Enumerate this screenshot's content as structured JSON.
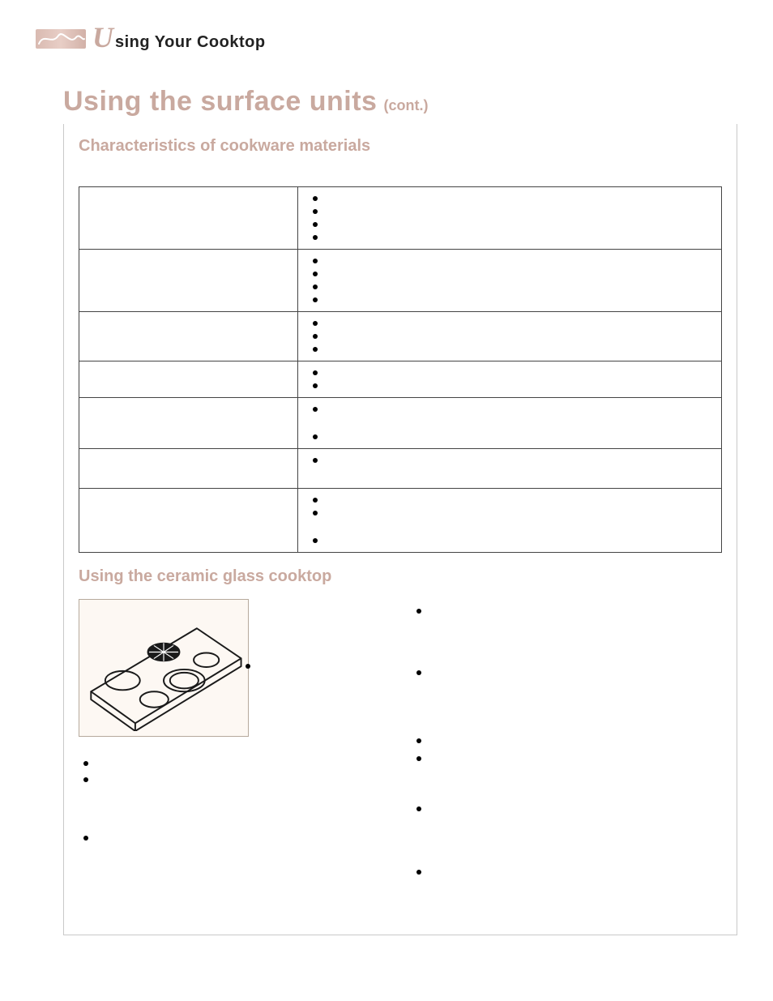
{
  "colors": {
    "accent": "#c9a99f",
    "text": "#222222",
    "rule": "#c9c9c9"
  },
  "header": {
    "brand_icon": "monogram-swatch",
    "script_letter": "U",
    "title_rest": "sing Your Cooktop"
  },
  "section": {
    "title": "Using the surface units",
    "suffix": "(cont.)"
  },
  "characteristics": {
    "heading": "Characteristics of cookware materials",
    "rows": [
      {
        "material": "",
        "bullet_count": 4
      },
      {
        "material": "",
        "bullet_count": 4
      },
      {
        "material": "",
        "bullet_count": 3
      },
      {
        "material": "",
        "bullet_count": 2
      },
      {
        "material": "",
        "bullet_count": 2
      },
      {
        "material": "",
        "bullet_count": 1
      },
      {
        "material": "",
        "bullet_count": 3
      }
    ]
  },
  "ceramic": {
    "heading": "Using the ceramic glass cooktop",
    "figure_alt": "ceramic-glass-cooktop-illustration",
    "left_bullets": [
      "",
      "",
      "",
      ""
    ],
    "right_bullets": [
      "",
      "",
      "",
      "",
      "",
      "",
      ""
    ]
  }
}
